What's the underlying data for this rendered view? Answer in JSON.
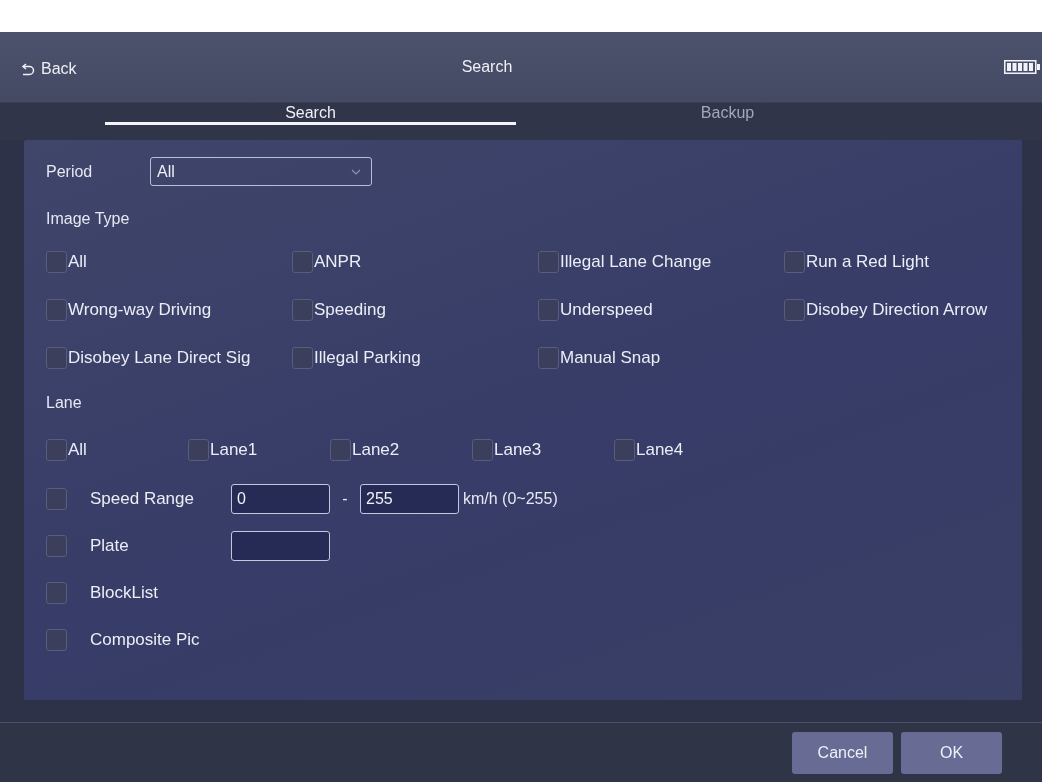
{
  "header": {
    "back": "Back",
    "title": "Search"
  },
  "tabs": [
    {
      "label": "Search",
      "selected": true
    },
    {
      "label": "Backup",
      "selected": false
    }
  ],
  "period": {
    "label": "Period",
    "value": "All"
  },
  "image_type": {
    "label": "Image Type",
    "options": [
      {
        "label": "All",
        "checked": false
      },
      {
        "label": "ANPR",
        "checked": false
      },
      {
        "label": "Illegal Lane Change",
        "checked": false
      },
      {
        "label": "Run a Red Light",
        "checked": false
      },
      {
        "label": "Wrong-way Driving",
        "checked": false
      },
      {
        "label": "Speeding",
        "checked": false
      },
      {
        "label": "Underspeed",
        "checked": false
      },
      {
        "label": "Disobey Direction Arrow",
        "checked": false
      },
      {
        "label": "Disobey Lane Direct Sig",
        "checked": false
      },
      {
        "label": "Illegal Parking",
        "checked": false
      },
      {
        "label": "Manual Snap",
        "checked": false
      }
    ]
  },
  "lane": {
    "label": "Lane",
    "options": [
      {
        "label": "All",
        "checked": false
      },
      {
        "label": "Lane1",
        "checked": false
      },
      {
        "label": "Lane2",
        "checked": false
      },
      {
        "label": "Lane3",
        "checked": false
      },
      {
        "label": "Lane4",
        "checked": false
      }
    ]
  },
  "filters": [
    {
      "kind": "range",
      "label": "Speed Range",
      "checked": false,
      "from": "0",
      "separator": "-",
      "to": "255",
      "unit": "km/h (0~255)"
    },
    {
      "kind": "text",
      "label": "Plate",
      "checked": false
    },
    {
      "kind": "check",
      "label": "BlockList",
      "checked": false
    },
    {
      "kind": "check",
      "label": "Composite Pic",
      "checked": false
    }
  ],
  "buttons": [
    {
      "label": "Cancel"
    },
    {
      "label": "OK"
    }
  ]
}
